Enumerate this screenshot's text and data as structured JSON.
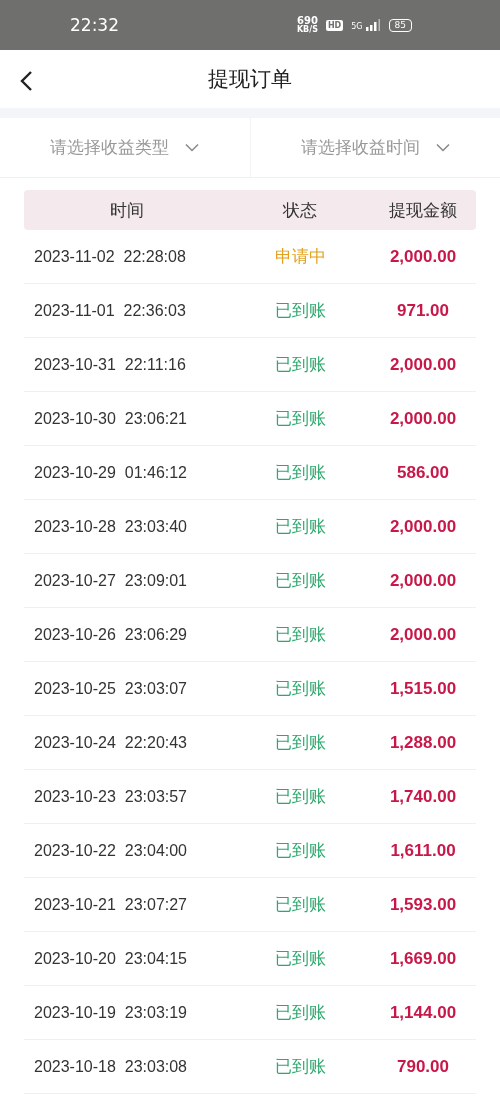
{
  "status_bar": {
    "time": "22:32",
    "speed": "690",
    "speed_unit": "KB/S",
    "hd": "HD",
    "network": "5G",
    "battery": "85"
  },
  "header": {
    "title": "提现订单"
  },
  "filters": [
    {
      "placeholder": "请选择收益类型"
    },
    {
      "placeholder": "请选择收益时间"
    }
  ],
  "table": {
    "columns": [
      "时间",
      "状态",
      "提现金额"
    ],
    "rows": [
      {
        "time": "2023-11-02  22:28:08",
        "status": "申请中",
        "kind": "pending",
        "amount": "2,000.00"
      },
      {
        "time": "2023-11-01  22:36:03",
        "status": "已到账",
        "kind": "done",
        "amount": "971.00"
      },
      {
        "time": "2023-10-31  22:11:16",
        "status": "已到账",
        "kind": "done",
        "amount": "2,000.00"
      },
      {
        "time": "2023-10-30  23:06:21",
        "status": "已到账",
        "kind": "done",
        "amount": "2,000.00"
      },
      {
        "time": "2023-10-29  01:46:12",
        "status": "已到账",
        "kind": "done",
        "amount": "586.00"
      },
      {
        "time": "2023-10-28  23:03:40",
        "status": "已到账",
        "kind": "done",
        "amount": "2,000.00"
      },
      {
        "time": "2023-10-27  23:09:01",
        "status": "已到账",
        "kind": "done",
        "amount": "2,000.00"
      },
      {
        "time": "2023-10-26  23:06:29",
        "status": "已到账",
        "kind": "done",
        "amount": "2,000.00"
      },
      {
        "time": "2023-10-25  23:03:07",
        "status": "已到账",
        "kind": "done",
        "amount": "1,515.00"
      },
      {
        "time": "2023-10-24  22:20:43",
        "status": "已到账",
        "kind": "done",
        "amount": "1,288.00"
      },
      {
        "time": "2023-10-23  23:03:57",
        "status": "已到账",
        "kind": "done",
        "amount": "1,740.00"
      },
      {
        "time": "2023-10-22  23:04:00",
        "status": "已到账",
        "kind": "done",
        "amount": "1,611.00"
      },
      {
        "time": "2023-10-21  23:07:27",
        "status": "已到账",
        "kind": "done",
        "amount": "1,593.00"
      },
      {
        "time": "2023-10-20  23:04:15",
        "status": "已到账",
        "kind": "done",
        "amount": "1,669.00"
      },
      {
        "time": "2023-10-19  23:03:19",
        "status": "已到账",
        "kind": "done",
        "amount": "1,144.00"
      },
      {
        "time": "2023-10-18  23:03:08",
        "status": "已到账",
        "kind": "done",
        "amount": "790.00"
      }
    ]
  }
}
